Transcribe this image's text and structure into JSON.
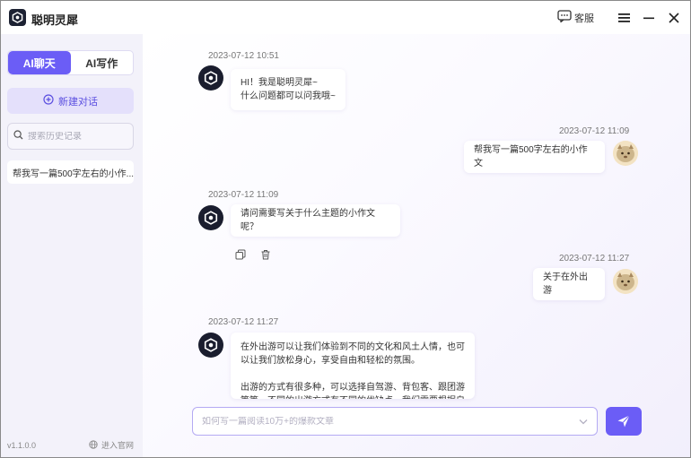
{
  "app": {
    "title": "聪明灵犀",
    "service_label": "客服"
  },
  "sidebar": {
    "tabs": [
      {
        "label": "AI聊天"
      },
      {
        "label": "AI写作"
      }
    ],
    "new_chat_label": "新建对话",
    "search_placeholder": "搜索历史记录",
    "history": [
      {
        "title": "帮我写一篇500字左右的小作..."
      }
    ],
    "version": "v1.1.0.0",
    "website_label": "进入官网"
  },
  "messages": [
    {
      "role": "bot",
      "time": "2023-07-12 10:51",
      "lines": [
        "HI！我是聪明灵犀~",
        "什么问题都可以问我哦~"
      ]
    },
    {
      "role": "user",
      "time": "2023-07-12 11:09",
      "lines": [
        "帮我写一篇500字左右的小作文"
      ]
    },
    {
      "role": "bot",
      "time": "2023-07-12 11:09",
      "lines": [
        "请问需要写关于什么主题的小作文呢？"
      ]
    },
    {
      "role": "user",
      "time": "2023-07-12 11:27",
      "lines": [
        "关于在外出游"
      ]
    },
    {
      "role": "bot",
      "time": "2023-07-12 11:27",
      "paragraphs": [
        "在外出游可以让我们体验到不同的文化和风土人情，也可以让我们放松身心，享受自由和轻松的氛围。",
        "出游的方式有很多种，可以选择自驾游、背包客、跟团游等等。不同的出游方式有不同的优缺点，我们需要根据自"
      ]
    }
  ],
  "composer": {
    "placeholder": "如何写一篇阅读10万+的爆款文章"
  },
  "colors": {
    "accent": "#6b5df6",
    "accent_light": "#e4e0fb",
    "bot_avatar": "#1a1d2e"
  }
}
